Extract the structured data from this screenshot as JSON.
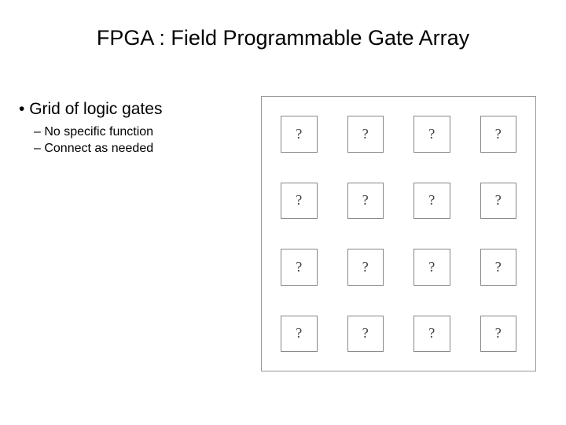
{
  "title": "FPGA : Field Programmable Gate Array",
  "main_bullet": "Grid of logic gates",
  "sub_bullets": [
    "No specific function",
    "Connect as needed"
  ],
  "grid": {
    "cells": [
      "?",
      "?",
      "?",
      "?",
      "?",
      "?",
      "?",
      "?",
      "?",
      "?",
      "?",
      "?",
      "?",
      "?",
      "?",
      "?"
    ]
  }
}
